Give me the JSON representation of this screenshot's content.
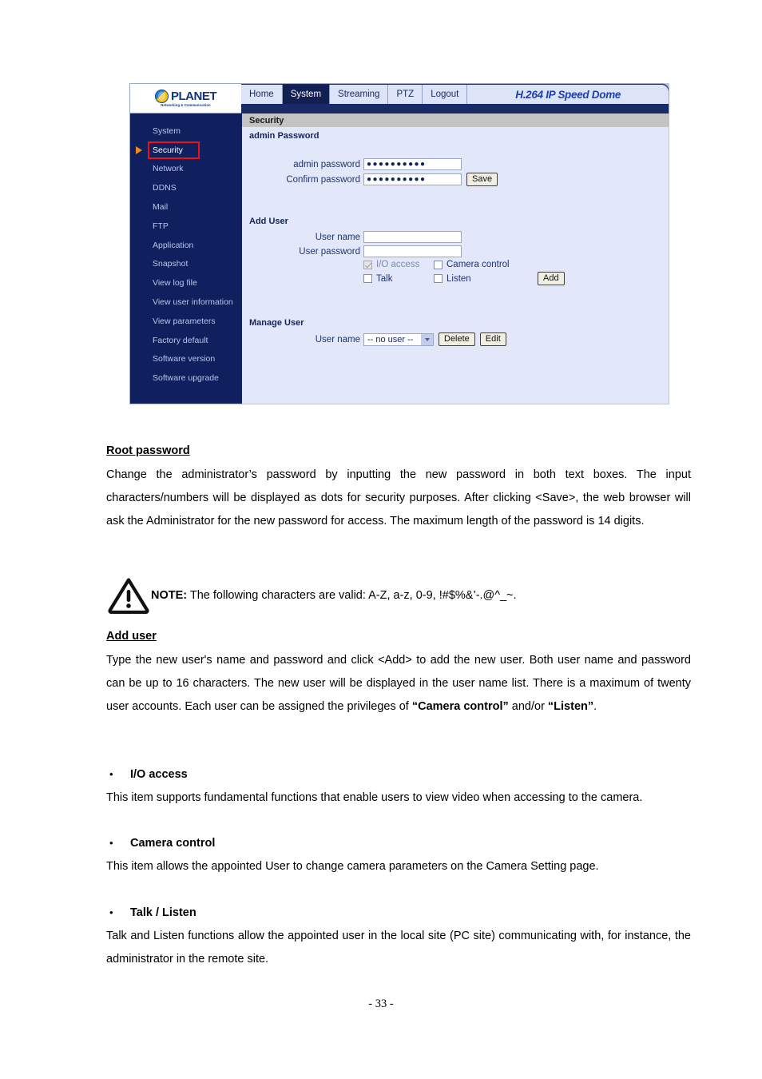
{
  "screenshot": {
    "logo": {
      "name": "PLANET",
      "tagline": "Networking & Communication"
    },
    "nav_tabs": [
      {
        "label": "Home",
        "active": false
      },
      {
        "label": "System",
        "active": true
      },
      {
        "label": "Streaming",
        "active": false
      },
      {
        "label": "PTZ",
        "active": false
      },
      {
        "label": "Logout",
        "active": false
      }
    ],
    "product_banner": "H.264 IP Speed Dome",
    "sidebar": {
      "items": [
        {
          "label": "System",
          "selected": false
        },
        {
          "label": "Security",
          "selected": true
        },
        {
          "label": "Network",
          "selected": false
        },
        {
          "label": "DDNS",
          "selected": false
        },
        {
          "label": "Mail",
          "selected": false
        },
        {
          "label": "FTP",
          "selected": false
        },
        {
          "label": "Application",
          "selected": false
        },
        {
          "label": "Snapshot",
          "selected": false
        },
        {
          "label": "View log file",
          "selected": false
        },
        {
          "label": "View user information",
          "selected": false
        },
        {
          "label": "View parameters",
          "selected": false
        },
        {
          "label": "Factory default",
          "selected": false
        },
        {
          "label": "Software version",
          "selected": false
        },
        {
          "label": "Software upgrade",
          "selected": false
        }
      ],
      "highlight_color": "#ee1111",
      "arrow_color": "#f08a18"
    },
    "panel": {
      "title": "Security",
      "admin_password_section": {
        "heading": "admin Password",
        "fields": [
          {
            "label": "admin password",
            "value": "●●●●●●●●●●"
          },
          {
            "label": "Confirm password",
            "value": "●●●●●●●●●●"
          }
        ],
        "save_label": "Save"
      },
      "add_user_section": {
        "heading": "Add User",
        "fields": [
          {
            "label": "User name",
            "value": ""
          },
          {
            "label": "User password",
            "value": ""
          }
        ],
        "checkboxes": [
          {
            "label": "I/O access",
            "checked": true,
            "disabled": true
          },
          {
            "label": "Camera control",
            "checked": false,
            "disabled": false
          },
          {
            "label": "Talk",
            "checked": false,
            "disabled": false
          },
          {
            "label": "Listen",
            "checked": false,
            "disabled": false
          }
        ],
        "add_label": "Add"
      },
      "manage_user_section": {
        "heading": "Manage User",
        "user_name_label": "User name",
        "selected_user": "-- no user --",
        "delete_label": "Delete",
        "edit_label": "Edit"
      }
    }
  },
  "document": {
    "root_password": {
      "heading": "Root password",
      "body": "Change the administrator’s password by inputting the new password in both text boxes. The input characters/numbers will be displayed as dots for security purposes. After clicking <Save>, the web browser will ask the Administrator for the new password for access. The maximum length of the password is 14 digits."
    },
    "note": {
      "label": "NOTE:",
      "text": " The following characters are valid: A-Z, a-z, 0-9, !#$%&’-.@^_~."
    },
    "add_user": {
      "heading": "Add user",
      "body_1": "Type the new user's name and password and click <Add> to add the new user. Both user name and password can be up to 16 characters. The new user will be displayed in the user name list. There is a maximum of twenty user accounts. Each user can be assigned the privileges of ",
      "bold_1": "“Camera control”",
      "body_2": " and/or ",
      "bold_2": "“Listen”",
      "body_3": "."
    },
    "bullets": [
      {
        "marker": "•",
        "heading": "I/O access",
        "body": "This item supports fundamental functions that enable users to view video when accessing to the camera."
      },
      {
        "marker": "•",
        "heading": "Camera control",
        "body": "This item allows the appointed User to change camera parameters on the Camera Setting page."
      },
      {
        "marker": "•",
        "heading": "Talk / Listen",
        "body": "Talk and Listen functions allow the appointed user in the local site (PC site) communicating with, for instance, the administrator in the remote site."
      }
    ],
    "page_number": "- 33 -"
  }
}
